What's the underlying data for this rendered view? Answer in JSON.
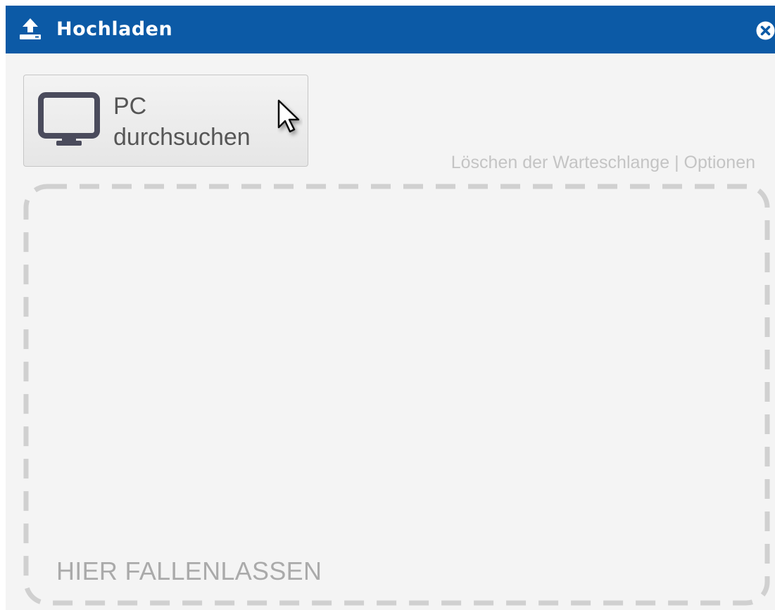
{
  "dialog": {
    "title": "Hochladen",
    "title_icon": "upload-icon",
    "close_icon": "close-icon",
    "accent_color": "#0c5aa6"
  },
  "browse": {
    "icon": "monitor-icon",
    "label_line1": "PC",
    "label_line2": "durchsuchen"
  },
  "queue": {
    "clear_label": "Löschen der Warteschlange",
    "separator": "|",
    "options_label": "Optionen"
  },
  "drop_zone": {
    "label": "HIER FALLENLASSEN"
  },
  "pointer": {
    "icon": "mouse-cursor-icon"
  }
}
